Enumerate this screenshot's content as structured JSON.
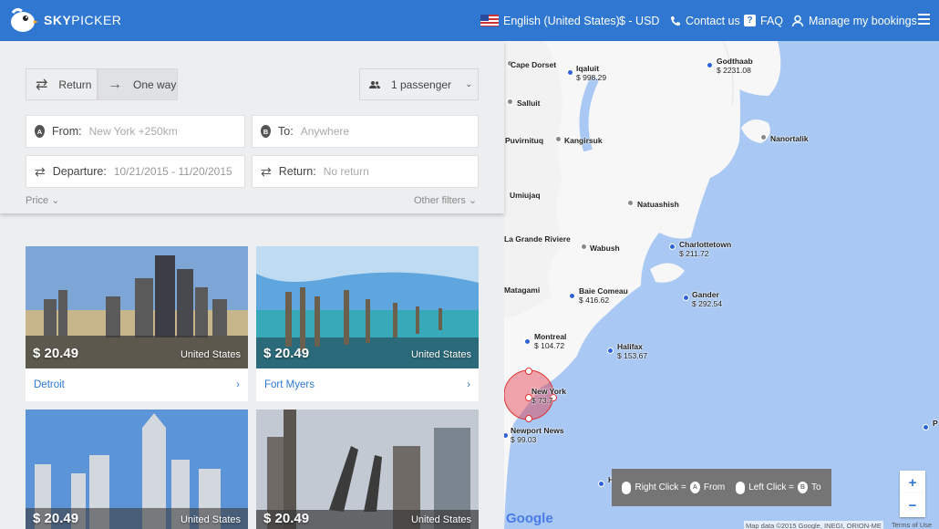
{
  "header": {
    "brand_bold": "SKY",
    "brand_light": "PICKER",
    "language": "English (United States)",
    "currency": "$ - USD",
    "contact": "Contact us",
    "faq": "FAQ",
    "faq_glyph": "?",
    "bookings": "Manage my bookings"
  },
  "search": {
    "trip_types": [
      "Return",
      "One way"
    ],
    "selected_trip_type": "One way",
    "passengers": "1 passenger",
    "from_label": "From:",
    "from_value": "New York +250km",
    "to_label": "To:",
    "to_value": "Anywhere",
    "departure_label": "Departure:",
    "departure_value": "10/21/2015 - 11/20/2015",
    "return_label": "Return:",
    "return_value": "No return",
    "price_filter": "Price",
    "other_filters": "Other filters",
    "pin_a": "A",
    "pin_b": "B"
  },
  "results": [
    {
      "price": "$ 20.49",
      "country": "United States",
      "city": "Detroit"
    },
    {
      "price": "$ 20.49",
      "country": "United States",
      "city": "Fort Myers"
    },
    {
      "price": "$ 20.49",
      "country": "United States",
      "city": ""
    },
    {
      "price": "$ 20.49",
      "country": "United States",
      "city": ""
    }
  ],
  "map": {
    "cities": [
      {
        "name": "Cape Dorset",
        "price": ""
      },
      {
        "name": "Iqaluit",
        "price": "$ 998.29"
      },
      {
        "name": "Godthaab",
        "price": "$ 2231.08"
      },
      {
        "name": "Salluit",
        "price": ""
      },
      {
        "name": "Puvirnituq",
        "price": ""
      },
      {
        "name": "Kangirsuk",
        "price": ""
      },
      {
        "name": "Nanortalik",
        "price": ""
      },
      {
        "name": "Umiujaq",
        "price": ""
      },
      {
        "name": "Natuashish",
        "price": ""
      },
      {
        "name": "La Grande Riviere",
        "price": ""
      },
      {
        "name": "Wabush",
        "price": ""
      },
      {
        "name": "Charlottetown",
        "price": "$ 211.72"
      },
      {
        "name": "Matagami",
        "price": ""
      },
      {
        "name": "Baie Comeau",
        "price": "$ 416.62"
      },
      {
        "name": "Gander",
        "price": "$ 292.54"
      },
      {
        "name": "Montreal",
        "price": "$ 104.72"
      },
      {
        "name": "Halifax",
        "price": "$ 153.67"
      },
      {
        "name": "New York",
        "price": "$ 73.7"
      },
      {
        "name": "Newport News",
        "price": "$ 99.03"
      },
      {
        "name": "Ham",
        "price": ""
      }
    ],
    "legend_right_click": "Right Click =",
    "legend_from": "From",
    "legend_left_click": "Left Click =",
    "legend_to": "To",
    "zoom_in": "+",
    "zoom_out": "−",
    "google": "Google",
    "attribution": "Map data ©2015 Google, INEGI, ORION-ME",
    "terms": "Terms of Use",
    "edge_label": "P"
  },
  "colors": {
    "brand": "#2f77d0",
    "map_water": "#a9c8f3",
    "land": "#f7f7f7",
    "pin_blue": "#2d62d8"
  }
}
